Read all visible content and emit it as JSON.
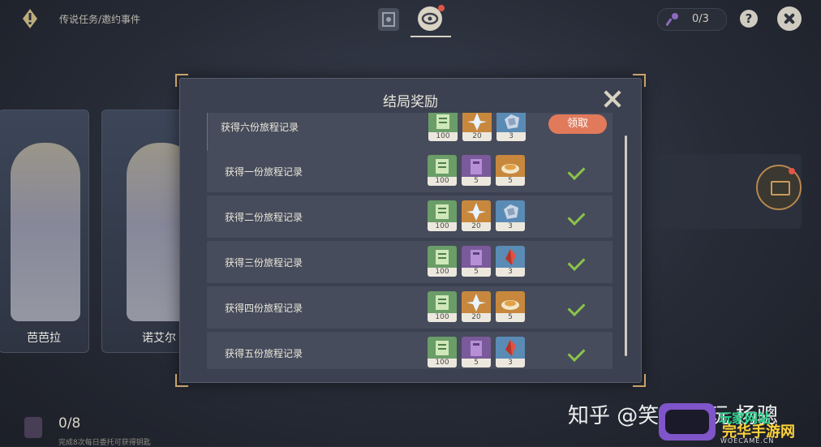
{
  "header": {
    "breadcrumb": "传说任务/邀约事件",
    "keys": "0/3",
    "help": "?"
  },
  "characters": [
    {
      "name": "芭芭拉"
    },
    {
      "name": "诺艾尔"
    }
  ],
  "bottom": {
    "progress": "0/8",
    "description": "完成8次每日委托可获得钥匙"
  },
  "modal": {
    "title": "结局奖励",
    "claim_label": "领取",
    "rows": [
      {
        "label": "获得六份旅程记录",
        "claimable": true,
        "items": [
          {
            "icon": "xp-book-icon",
            "count": "100",
            "color": "#6a9d68"
          },
          {
            "icon": "intertwined-fate-icon",
            "count": "20",
            "color": "#c7883e"
          },
          {
            "icon": "mystic-ore-icon",
            "count": "3",
            "color": "#5a8bb5"
          }
        ]
      },
      {
        "label": "获得一份旅程记录",
        "claimable": false,
        "items": [
          {
            "icon": "xp-book-icon",
            "count": "100",
            "color": "#6a9d68"
          },
          {
            "icon": "wits-book-icon",
            "count": "5",
            "color": "#7a5a9a"
          },
          {
            "icon": "food-dish-icon",
            "count": "5",
            "color": "#c7883e"
          }
        ]
      },
      {
        "label": "获得二份旅程记录",
        "claimable": false,
        "items": [
          {
            "icon": "xp-book-icon",
            "count": "100",
            "color": "#6a9d68"
          },
          {
            "icon": "intertwined-fate-icon",
            "count": "20",
            "color": "#c7883e"
          },
          {
            "icon": "mystic-ore-icon",
            "count": "3",
            "color": "#5a8bb5"
          }
        ]
      },
      {
        "label": "获得三份旅程记录",
        "claimable": false,
        "items": [
          {
            "icon": "xp-book-icon",
            "count": "100",
            "color": "#6a9d68"
          },
          {
            "icon": "wits-book-icon",
            "count": "5",
            "color": "#7a5a9a"
          },
          {
            "icon": "red-crystal-icon",
            "count": "3",
            "color": "#5a8bb5"
          }
        ]
      },
      {
        "label": "获得四份旅程记录",
        "claimable": false,
        "items": [
          {
            "icon": "xp-book-icon",
            "count": "100",
            "color": "#6a9d68"
          },
          {
            "icon": "intertwined-fate-icon",
            "count": "20",
            "color": "#c7883e"
          },
          {
            "icon": "food-dish-icon",
            "count": "5",
            "color": "#c7883e"
          }
        ]
      },
      {
        "label": "获得五份旅程记录",
        "claimable": false,
        "items": [
          {
            "icon": "xp-book-icon",
            "count": "100",
            "color": "#6a9d68"
          },
          {
            "icon": "wits-book-icon",
            "count": "5",
            "color": "#7a5a9a"
          },
          {
            "icon": "red-crystal-icon",
            "count": "3",
            "color": "#5a8bb5"
          }
        ]
      }
    ]
  },
  "watermark": {
    "text": "知乎 @笑 舍皓玩 杨骢",
    "brand_top": "玩家网站",
    "brand_bottom": "完华手游网",
    "url": "WOECAME.CN"
  }
}
